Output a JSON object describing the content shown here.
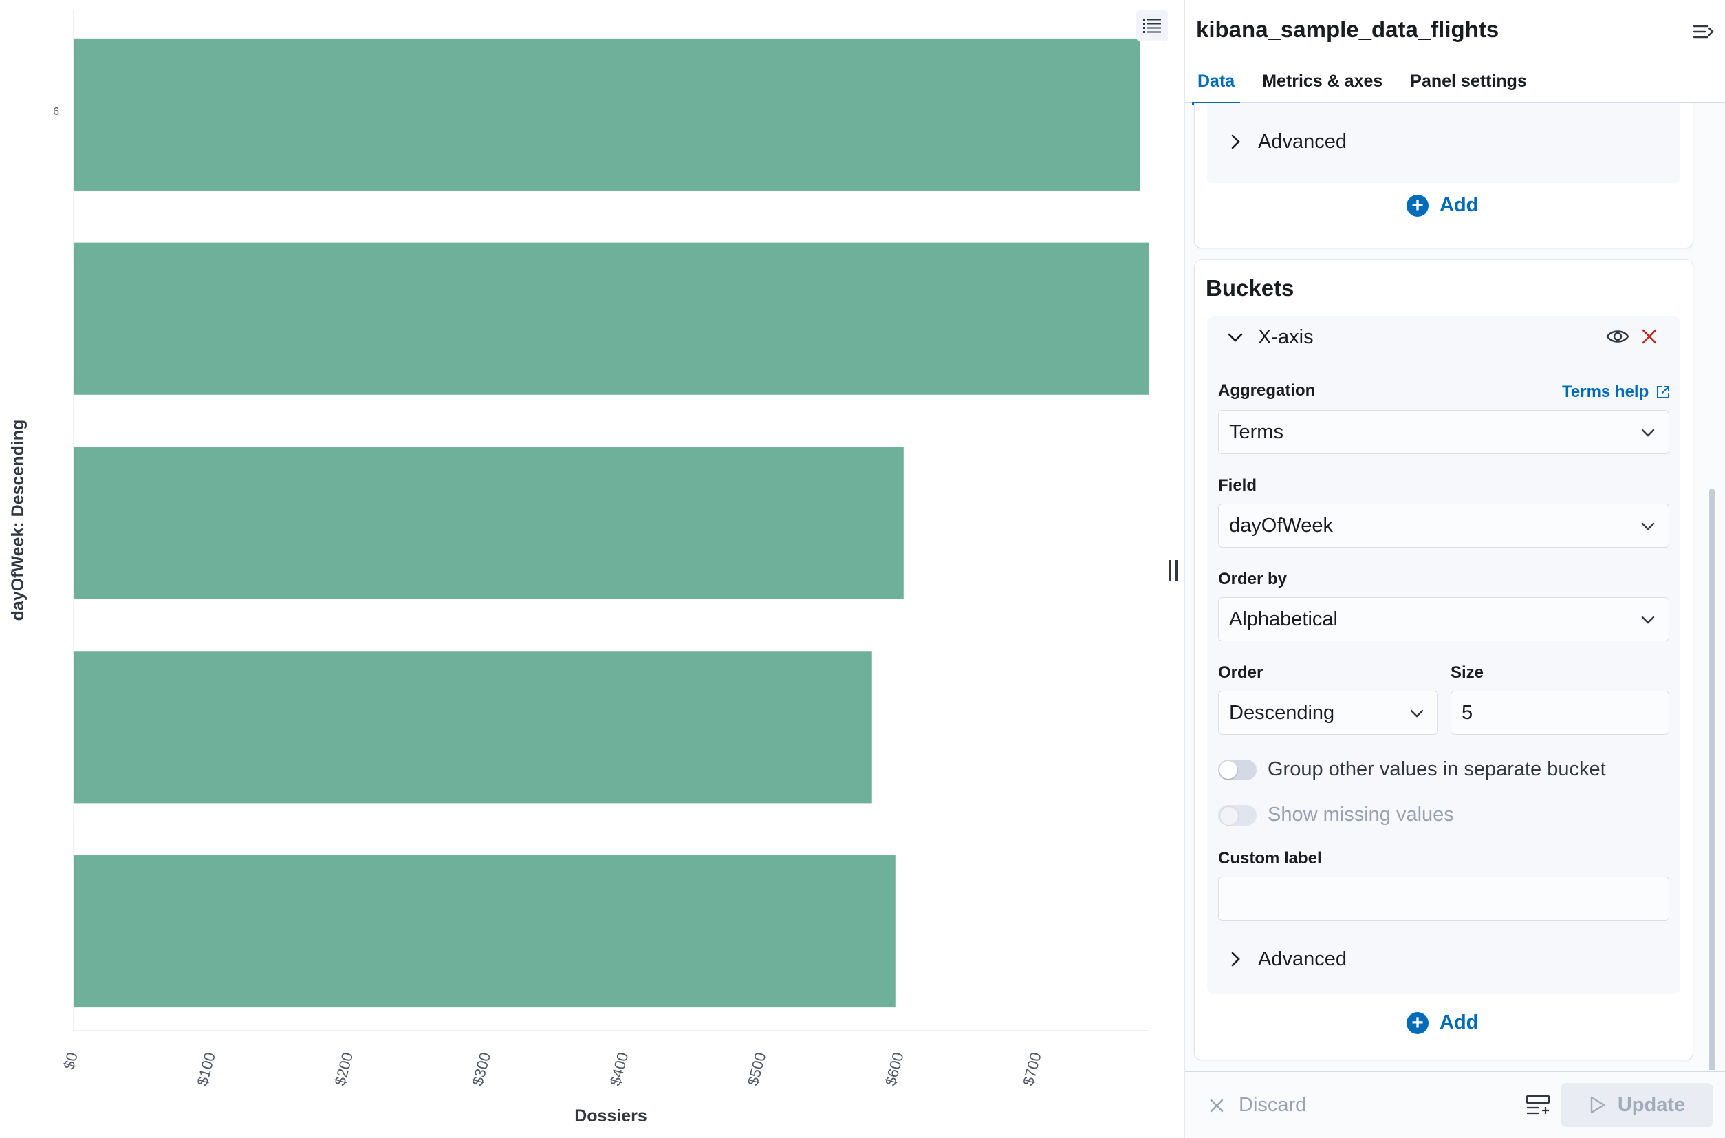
{
  "chart_data": {
    "type": "bar",
    "orientation": "horizontal",
    "categories": [
      "",
      "",
      "",
      "",
      ""
    ],
    "values": [
      775,
      781,
      603,
      580,
      597
    ],
    "xlabel": "Dossiers",
    "ylabel": "dayOfWeek: Descending",
    "xlim": [
      0,
      781
    ],
    "xticks": [
      "$0",
      "$100",
      "$200",
      "$300",
      "$400",
      "$500",
      "$600",
      "$700"
    ],
    "xtick_values": [
      0,
      100,
      200,
      300,
      400,
      500,
      600,
      700
    ],
    "category_label_visible": "6",
    "bar_color": "#6eb09a",
    "grid": false
  },
  "panel": {
    "title": "kibana_sample_data_flights",
    "tabs": [
      "Data",
      "Metrics & axes",
      "Panel settings"
    ],
    "active_tab": "Data",
    "metrics": {
      "advanced_label": "Advanced",
      "add_label": "Add"
    },
    "buckets": {
      "title": "Buckets",
      "item_label": "X-axis",
      "aggregation_label": "Aggregation",
      "help_link": "Terms help",
      "aggregation_value": "Terms",
      "field_label": "Field",
      "field_value": "dayOfWeek",
      "order_by_label": "Order by",
      "order_by_value": "Alphabetical",
      "order_label": "Order",
      "order_value": "Descending",
      "size_label": "Size",
      "size_value": "5",
      "group_other_label": "Group other values in separate bucket",
      "show_missing_label": "Show missing values",
      "custom_label_label": "Custom label",
      "custom_label_value": "",
      "advanced_label": "Advanced",
      "add_label": "Add"
    },
    "footer": {
      "discard_label": "Discard",
      "update_label": "Update"
    }
  },
  "colors": {
    "accent": "#006bb8",
    "bar": "#6eb09a",
    "delete": "#bd271e"
  }
}
